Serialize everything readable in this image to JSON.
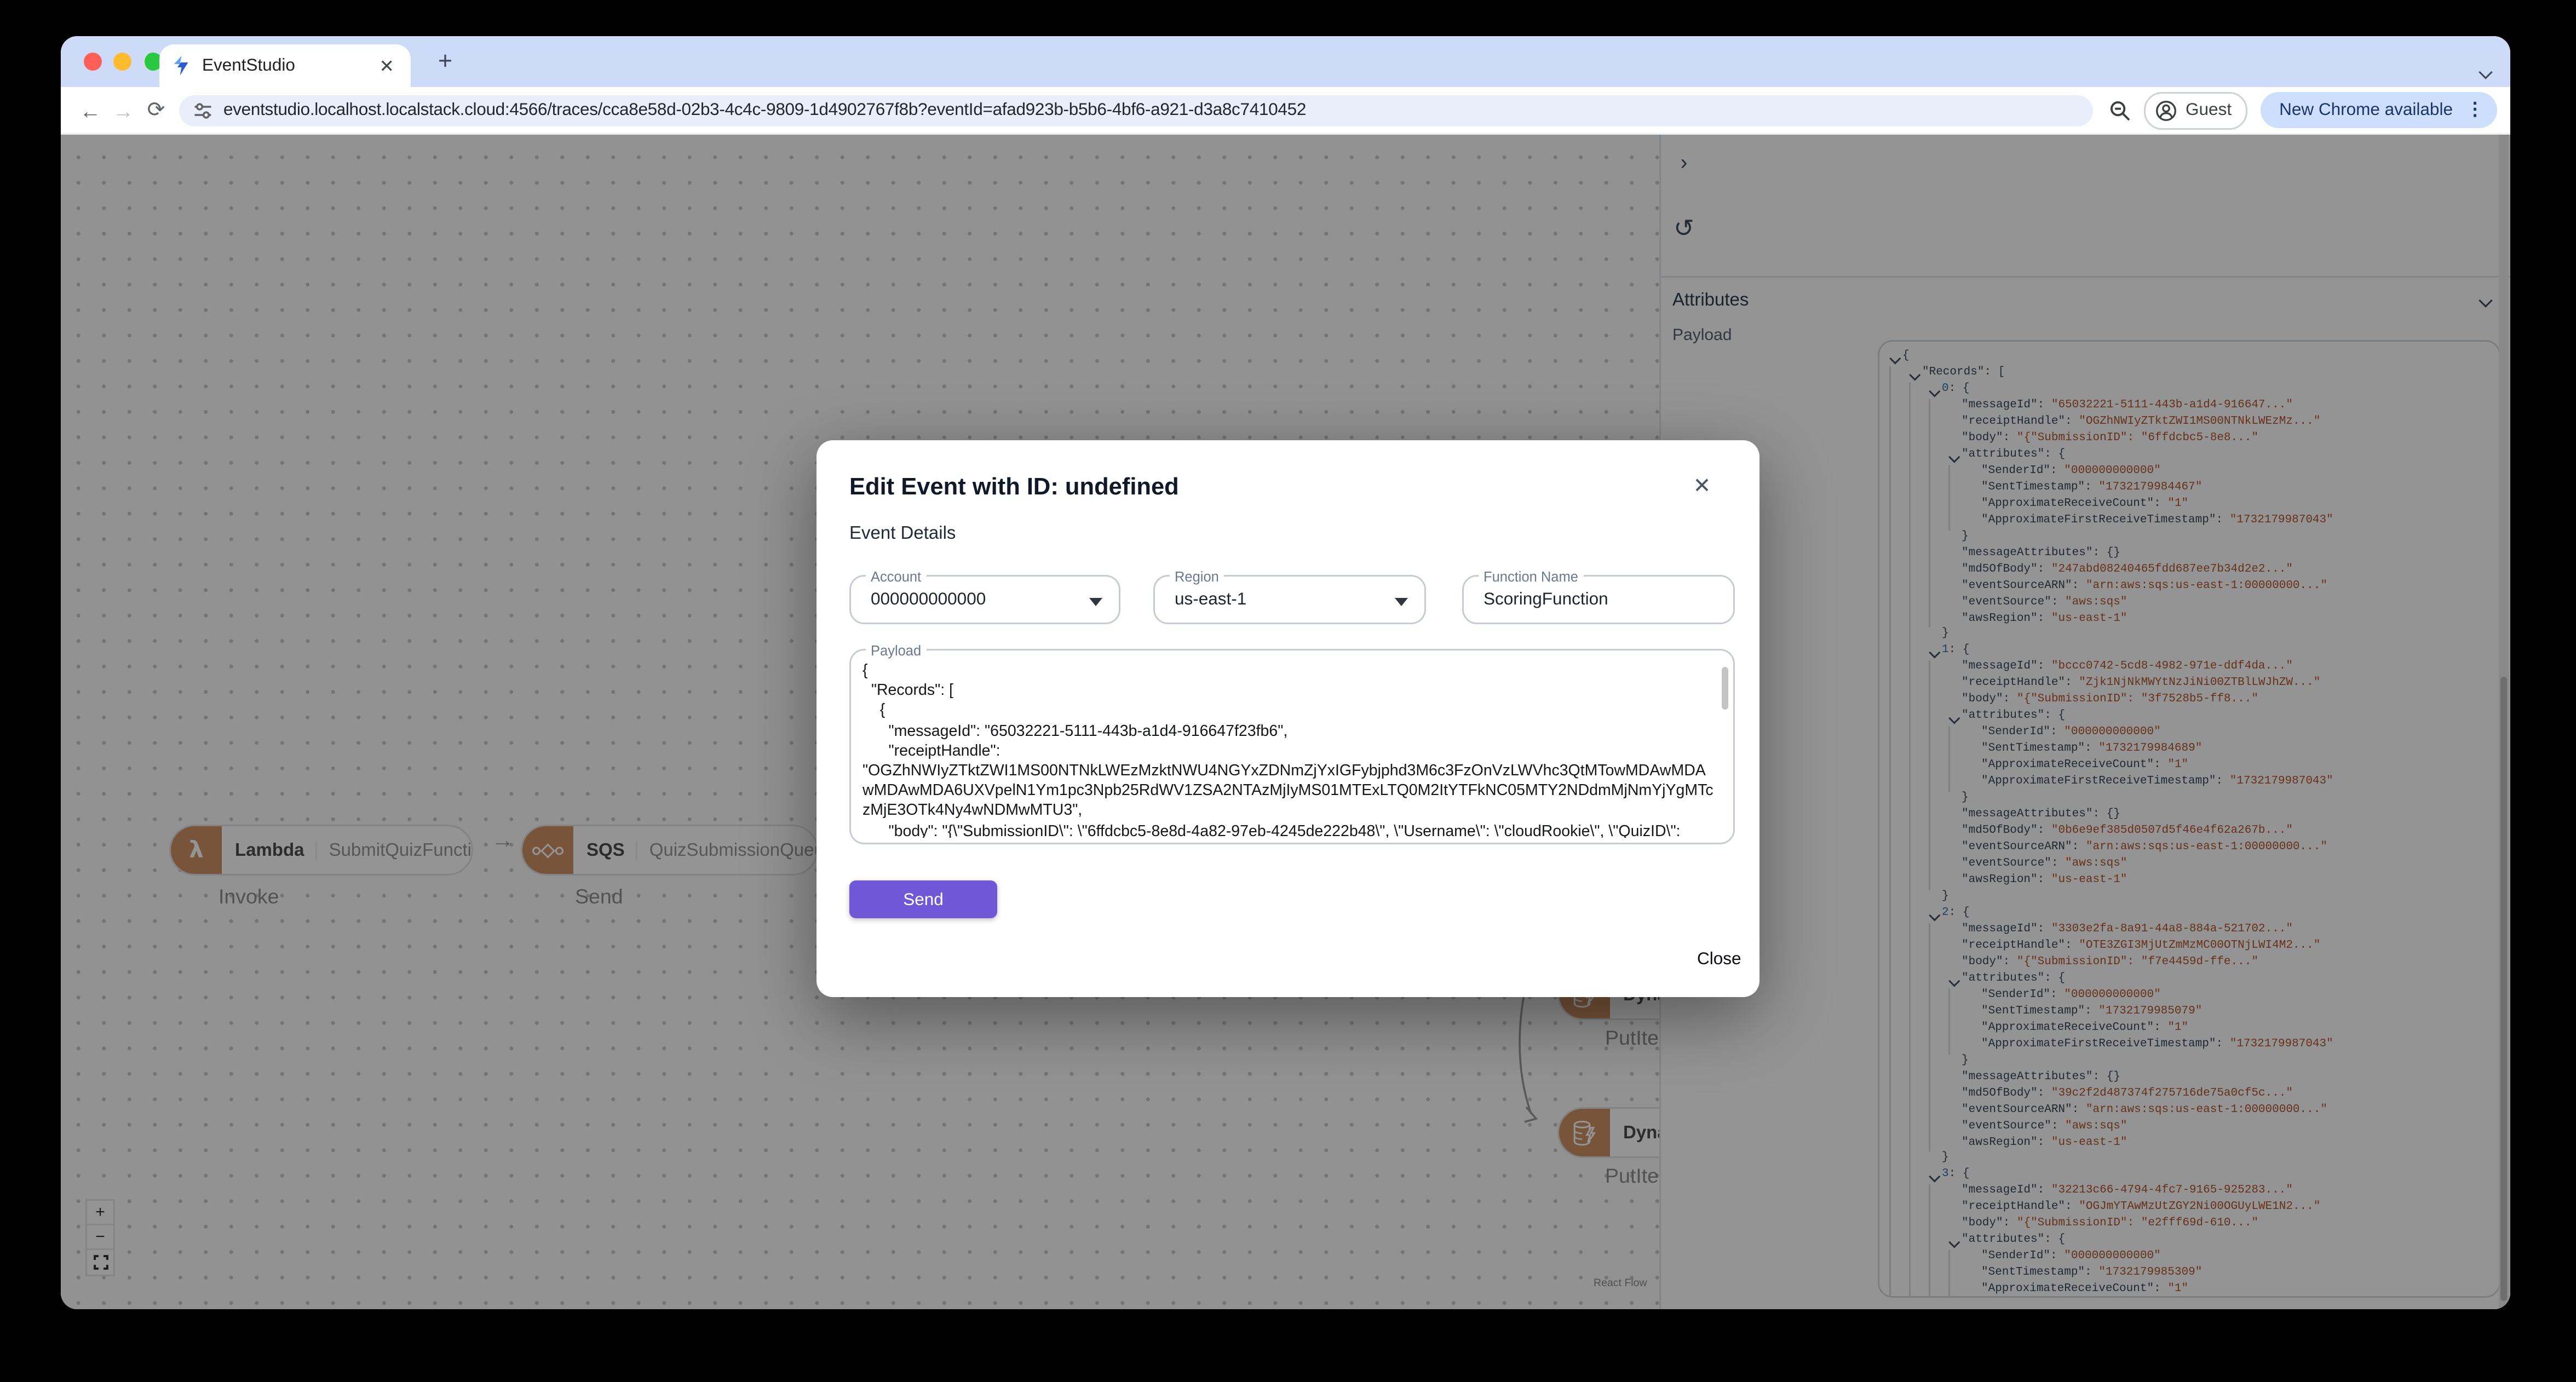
{
  "browser": {
    "tab_title": "EventStudio",
    "tab_close": "✕",
    "new_tab": "+",
    "back": "←",
    "forward": "→",
    "reload": "⟳",
    "url": "eventstudio.localhost.localstack.cloud:4566/traces/cca8e58d-02b3-4c4c-9809-1d4902767f8b?eventId=afad923b-b5b6-4bf6-a921-d3a8c7410452",
    "profile_label": "Guest",
    "update_pill": "New Chrome available",
    "menu_dots": "⋮"
  },
  "canvas": {
    "nodes": [
      {
        "service": "Lambda",
        "name": "SubmitQuizFunction",
        "edge_label": "Invoke"
      },
      {
        "service": "SQS",
        "name": "QuizSubmissionQueue",
        "edge_label": "Send"
      },
      {
        "service": "Dyna",
        "name": "",
        "edge_label": "PutIte"
      },
      {
        "service": "Dyna",
        "name": "",
        "edge_label": "PutIte"
      }
    ],
    "arrow": "→",
    "zoom_in": "+",
    "zoom_out": "−",
    "attribution": "React Flow"
  },
  "panel": {
    "collapse_icon": "›",
    "refresh_icon": "↺",
    "attributes_label": "Attributes",
    "payload_label": "Payload",
    "tree": {
      "lines": [
        {
          "d": 0,
          "c": 1,
          "s": [
            [
              "b",
              "{"
            ]
          ]
        },
        {
          "d": 1,
          "c": 1,
          "s": [
            [
              "k",
              "\"Records\""
            ],
            [
              "p",
              ": "
            ],
            [
              "b",
              "["
            ]
          ]
        },
        {
          "d": 2,
          "c": 1,
          "s": [
            [
              "i",
              "0"
            ],
            [
              "p",
              ": "
            ],
            [
              "b",
              "{"
            ]
          ]
        },
        {
          "d": 3,
          "c": 0,
          "s": [
            [
              "k",
              "\"messageId\""
            ],
            [
              "p",
              ": "
            ],
            [
              "s",
              "\"65032221-5111-443b-a1d4-916647...\""
            ]
          ]
        },
        {
          "d": 3,
          "c": 0,
          "s": [
            [
              "k",
              "\"receiptHandle\""
            ],
            [
              "p",
              ": "
            ],
            [
              "s",
              "\"OGZhNWIyZTktZWI1MS00NTNkLWEzMz...\""
            ]
          ]
        },
        {
          "d": 3,
          "c": 0,
          "s": [
            [
              "k",
              "\"body\""
            ],
            [
              "p",
              ": "
            ],
            [
              "s",
              "\"{\"SubmissionID\": \"6ffdcbc5-8e8...\""
            ]
          ]
        },
        {
          "d": 3,
          "c": 1,
          "s": [
            [
              "k",
              "\"attributes\""
            ],
            [
              "p",
              ": "
            ],
            [
              "b",
              "{"
            ]
          ]
        },
        {
          "d": 4,
          "c": 0,
          "s": [
            [
              "k",
              "\"SenderId\""
            ],
            [
              "p",
              ": "
            ],
            [
              "s",
              "\"000000000000\""
            ]
          ]
        },
        {
          "d": 4,
          "c": 0,
          "s": [
            [
              "k",
              "\"SentTimestamp\""
            ],
            [
              "p",
              ": "
            ],
            [
              "s",
              "\"1732179984467\""
            ]
          ]
        },
        {
          "d": 4,
          "c": 0,
          "s": [
            [
              "k",
              "\"ApproximateReceiveCount\""
            ],
            [
              "p",
              ": "
            ],
            [
              "s",
              "\"1\""
            ]
          ]
        },
        {
          "d": 4,
          "c": 0,
          "s": [
            [
              "k",
              "\"ApproximateFirstReceiveTimestamp\""
            ],
            [
              "p",
              ": "
            ],
            [
              "s",
              "\"1732179987043\""
            ]
          ]
        },
        {
          "d": 3,
          "c": 0,
          "s": [
            [
              "b",
              "}"
            ]
          ]
        },
        {
          "d": 3,
          "c": 0,
          "s": [
            [
              "k",
              "\"messageAttributes\""
            ],
            [
              "p",
              ": "
            ],
            [
              "b",
              "{}"
            ]
          ]
        },
        {
          "d": 3,
          "c": 0,
          "s": [
            [
              "k",
              "\"md5OfBody\""
            ],
            [
              "p",
              ": "
            ],
            [
              "s",
              "\"247abd08240465fdd687ee7b34d2e2...\""
            ]
          ]
        },
        {
          "d": 3,
          "c": 0,
          "s": [
            [
              "k",
              "\"eventSourceARN\""
            ],
            [
              "p",
              ": "
            ],
            [
              "s",
              "\"arn:aws:sqs:us-east-1:00000000...\""
            ]
          ]
        },
        {
          "d": 3,
          "c": 0,
          "s": [
            [
              "k",
              "\"eventSource\""
            ],
            [
              "p",
              ": "
            ],
            [
              "s",
              "\"aws:sqs\""
            ]
          ]
        },
        {
          "d": 3,
          "c": 0,
          "s": [
            [
              "k",
              "\"awsRegion\""
            ],
            [
              "p",
              ": "
            ],
            [
              "s",
              "\"us-east-1\""
            ]
          ]
        },
        {
          "d": 2,
          "c": 0,
          "s": [
            [
              "b",
              "}"
            ]
          ]
        },
        {
          "d": 2,
          "c": 1,
          "s": [
            [
              "i",
              "1"
            ],
            [
              "p",
              ": "
            ],
            [
              "b",
              "{"
            ]
          ]
        },
        {
          "d": 3,
          "c": 0,
          "s": [
            [
              "k",
              "\"messageId\""
            ],
            [
              "p",
              ": "
            ],
            [
              "s",
              "\"bccc0742-5cd8-4982-971e-ddf4da...\""
            ]
          ]
        },
        {
          "d": 3,
          "c": 0,
          "s": [
            [
              "k",
              "\"receiptHandle\""
            ],
            [
              "p",
              ": "
            ],
            [
              "s",
              "\"Zjk1NjNkMWYtNzJiNi00ZTBlLWJhZW...\""
            ]
          ]
        },
        {
          "d": 3,
          "c": 0,
          "s": [
            [
              "k",
              "\"body\""
            ],
            [
              "p",
              ": "
            ],
            [
              "s",
              "\"{\"SubmissionID\": \"3f7528b5-ff8...\""
            ]
          ]
        },
        {
          "d": 3,
          "c": 1,
          "s": [
            [
              "k",
              "\"attributes\""
            ],
            [
              "p",
              ": "
            ],
            [
              "b",
              "{"
            ]
          ]
        },
        {
          "d": 4,
          "c": 0,
          "s": [
            [
              "k",
              "\"SenderId\""
            ],
            [
              "p",
              ": "
            ],
            [
              "s",
              "\"000000000000\""
            ]
          ]
        },
        {
          "d": 4,
          "c": 0,
          "s": [
            [
              "k",
              "\"SentTimestamp\""
            ],
            [
              "p",
              ": "
            ],
            [
              "s",
              "\"1732179984689\""
            ]
          ]
        },
        {
          "d": 4,
          "c": 0,
          "s": [
            [
              "k",
              "\"ApproximateReceiveCount\""
            ],
            [
              "p",
              ": "
            ],
            [
              "s",
              "\"1\""
            ]
          ]
        },
        {
          "d": 4,
          "c": 0,
          "s": [
            [
              "k",
              "\"ApproximateFirstReceiveTimestamp\""
            ],
            [
              "p",
              ": "
            ],
            [
              "s",
              "\"1732179987043\""
            ]
          ]
        },
        {
          "d": 3,
          "c": 0,
          "s": [
            [
              "b",
              "}"
            ]
          ]
        },
        {
          "d": 3,
          "c": 0,
          "s": [
            [
              "k",
              "\"messageAttributes\""
            ],
            [
              "p",
              ": "
            ],
            [
              "b",
              "{}"
            ]
          ]
        },
        {
          "d": 3,
          "c": 0,
          "s": [
            [
              "k",
              "\"md5OfBody\""
            ],
            [
              "p",
              ": "
            ],
            [
              "s",
              "\"0b6e9ef385d0507d5f46e4f62a267b...\""
            ]
          ]
        },
        {
          "d": 3,
          "c": 0,
          "s": [
            [
              "k",
              "\"eventSourceARN\""
            ],
            [
              "p",
              ": "
            ],
            [
              "s",
              "\"arn:aws:sqs:us-east-1:00000000...\""
            ]
          ]
        },
        {
          "d": 3,
          "c": 0,
          "s": [
            [
              "k",
              "\"eventSource\""
            ],
            [
              "p",
              ": "
            ],
            [
              "s",
              "\"aws:sqs\""
            ]
          ]
        },
        {
          "d": 3,
          "c": 0,
          "s": [
            [
              "k",
              "\"awsRegion\""
            ],
            [
              "p",
              ": "
            ],
            [
              "s",
              "\"us-east-1\""
            ]
          ]
        },
        {
          "d": 2,
          "c": 0,
          "s": [
            [
              "b",
              "}"
            ]
          ]
        },
        {
          "d": 2,
          "c": 1,
          "s": [
            [
              "i",
              "2"
            ],
            [
              "p",
              ": "
            ],
            [
              "b",
              "{"
            ]
          ]
        },
        {
          "d": 3,
          "c": 0,
          "s": [
            [
              "k",
              "\"messageId\""
            ],
            [
              "p",
              ": "
            ],
            [
              "s",
              "\"3303e2fa-8a91-44a8-884a-521702...\""
            ]
          ]
        },
        {
          "d": 3,
          "c": 0,
          "s": [
            [
              "k",
              "\"receiptHandle\""
            ],
            [
              "p",
              ": "
            ],
            [
              "s",
              "\"OTE3ZGI3MjUtZmMzMC00OTNjLWI4M2...\""
            ]
          ]
        },
        {
          "d": 3,
          "c": 0,
          "s": [
            [
              "k",
              "\"body\""
            ],
            [
              "p",
              ": "
            ],
            [
              "s",
              "\"{\"SubmissionID\": \"f7e4459d-ffe...\""
            ]
          ]
        },
        {
          "d": 3,
          "c": 1,
          "s": [
            [
              "k",
              "\"attributes\""
            ],
            [
              "p",
              ": "
            ],
            [
              "b",
              "{"
            ]
          ]
        },
        {
          "d": 4,
          "c": 0,
          "s": [
            [
              "k",
              "\"SenderId\""
            ],
            [
              "p",
              ": "
            ],
            [
              "s",
              "\"000000000000\""
            ]
          ]
        },
        {
          "d": 4,
          "c": 0,
          "s": [
            [
              "k",
              "\"SentTimestamp\""
            ],
            [
              "p",
              ": "
            ],
            [
              "s",
              "\"1732179985079\""
            ]
          ]
        },
        {
          "d": 4,
          "c": 0,
          "s": [
            [
              "k",
              "\"ApproximateReceiveCount\""
            ],
            [
              "p",
              ": "
            ],
            [
              "s",
              "\"1\""
            ]
          ]
        },
        {
          "d": 4,
          "c": 0,
          "s": [
            [
              "k",
              "\"ApproximateFirstReceiveTimestamp\""
            ],
            [
              "p",
              ": "
            ],
            [
              "s",
              "\"1732179987043\""
            ]
          ]
        },
        {
          "d": 3,
          "c": 0,
          "s": [
            [
              "b",
              "}"
            ]
          ]
        },
        {
          "d": 3,
          "c": 0,
          "s": [
            [
              "k",
              "\"messageAttributes\""
            ],
            [
              "p",
              ": "
            ],
            [
              "b",
              "{}"
            ]
          ]
        },
        {
          "d": 3,
          "c": 0,
          "s": [
            [
              "k",
              "\"md5OfBody\""
            ],
            [
              "p",
              ": "
            ],
            [
              "s",
              "\"39c2f2d487374f275716de75a0cf5c...\""
            ]
          ]
        },
        {
          "d": 3,
          "c": 0,
          "s": [
            [
              "k",
              "\"eventSourceARN\""
            ],
            [
              "p",
              ": "
            ],
            [
              "s",
              "\"arn:aws:sqs:us-east-1:00000000...\""
            ]
          ]
        },
        {
          "d": 3,
          "c": 0,
          "s": [
            [
              "k",
              "\"eventSource\""
            ],
            [
              "p",
              ": "
            ],
            [
              "s",
              "\"aws:sqs\""
            ]
          ]
        },
        {
          "d": 3,
          "c": 0,
          "s": [
            [
              "k",
              "\"awsRegion\""
            ],
            [
              "p",
              ": "
            ],
            [
              "s",
              "\"us-east-1\""
            ]
          ]
        },
        {
          "d": 2,
          "c": 0,
          "s": [
            [
              "b",
              "}"
            ]
          ]
        },
        {
          "d": 2,
          "c": 1,
          "s": [
            [
              "i",
              "3"
            ],
            [
              "p",
              ": "
            ],
            [
              "b",
              "{"
            ]
          ]
        },
        {
          "d": 3,
          "c": 0,
          "s": [
            [
              "k",
              "\"messageId\""
            ],
            [
              "p",
              ": "
            ],
            [
              "s",
              "\"32213c66-4794-4fc7-9165-925283...\""
            ]
          ]
        },
        {
          "d": 3,
          "c": 0,
          "s": [
            [
              "k",
              "\"receiptHandle\""
            ],
            [
              "p",
              ": "
            ],
            [
              "s",
              "\"OGJmYTAwMzUtZGY2Ni00OGUyLWE1N2...\""
            ]
          ]
        },
        {
          "d": 3,
          "c": 0,
          "s": [
            [
              "k",
              "\"body\""
            ],
            [
              "p",
              ": "
            ],
            [
              "s",
              "\"{\"SubmissionID\": \"e2fff69d-610...\""
            ]
          ]
        },
        {
          "d": 3,
          "c": 1,
          "s": [
            [
              "k",
              "\"attributes\""
            ],
            [
              "p",
              ": "
            ],
            [
              "b",
              "{"
            ]
          ]
        },
        {
          "d": 4,
          "c": 0,
          "s": [
            [
              "k",
              "\"SenderId\""
            ],
            [
              "p",
              ": "
            ],
            [
              "s",
              "\"000000000000\""
            ]
          ]
        },
        {
          "d": 4,
          "c": 0,
          "s": [
            [
              "k",
              "\"SentTimestamp\""
            ],
            [
              "p",
              ": "
            ],
            [
              "s",
              "\"1732179985309\""
            ]
          ]
        },
        {
          "d": 4,
          "c": 0,
          "s": [
            [
              "k",
              "\"ApproximateReceiveCount\""
            ],
            [
              "p",
              ": "
            ],
            [
              "s",
              "\"1\""
            ]
          ]
        }
      ]
    }
  },
  "modal": {
    "title": "Edit Event with ID: undefined",
    "close_icon": "✕",
    "subtitle": "Event Details",
    "fields": [
      {
        "label": "Account",
        "value": "000000000000"
      },
      {
        "label": "Region",
        "value": "us-east-1"
      },
      {
        "label": "Function Name",
        "value": "ScoringFunction"
      }
    ],
    "payload_label": "Payload",
    "payload_text": "{\n  \"Records\": [\n    {\n      \"messageId\": \"65032221-5111-443b-a1d4-916647f23fb6\",\n      \"receiptHandle\":\n\"OGZhNWIyZTktZWI1MS00NTNkLWEzMzktNWU4NGYxZDNmZjYxIGFybjphd3M6c3FzOnVzLWVhc3QtMTowMDAwMDAwMDAwMDA6UXVpelN1Ym1pc3Npb25RdWV1ZSA2NTAzMjIyMS01MTExLTQ0M2ItYTFkNC05MTY2NDdmMjNmYjYgMTczMjE3OTk4Ny4wNDMwMTU3\",\n      \"body\": \"{\\\"SubmissionID\\\": \\\"6ffdcbc5-8e8d-4a82-97eb-4245de222b48\\\", \\\"Username\\\": \\\"cloudRookie\\\", \\\"QuizID\\\": \\\"adorable-",
    "send_label": "Send",
    "close_label": "Close"
  },
  "colors": {
    "accent_purple": "#6f58d8",
    "node_orange": "#cf9164",
    "tabstrip_blue": "#cddaf8",
    "update_pill_bg": "#cddffc",
    "update_pill_text": "#1a356e",
    "json_key": "#3a4654",
    "json_string": "#b2542c"
  }
}
